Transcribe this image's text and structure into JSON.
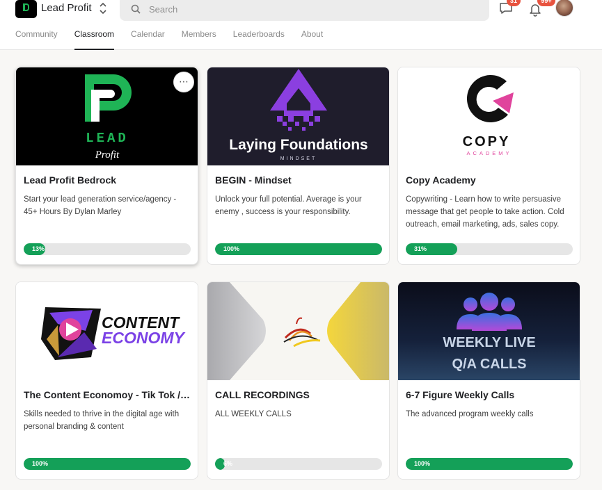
{
  "header": {
    "group_name": "Lead Profit",
    "search_placeholder": "Search",
    "chat_badge": "31",
    "notifications_badge": "99+"
  },
  "tabs": [
    {
      "label": "Community",
      "active": false
    },
    {
      "label": "Classroom",
      "active": true
    },
    {
      "label": "Calendar",
      "active": false
    },
    {
      "label": "Members",
      "active": false
    },
    {
      "label": "Leaderboards",
      "active": false
    },
    {
      "label": "About",
      "active": false
    }
  ],
  "courses": [
    {
      "title": "Lead Profit Bedrock",
      "description": "Start your lead generation service/agency - 45+ Hours By Dylan Marley",
      "progress": 13,
      "progress_label": "13%",
      "thumb": {
        "line1": "LEAD",
        "line2": "Profit"
      }
    },
    {
      "title": "BEGIN - Mindset",
      "description": "Unlock your full potential. Average is your enemy , success is your responsibility.",
      "progress": 100,
      "progress_label": "100%",
      "thumb": {
        "line1": "Laying Foundations",
        "line2": "MINDSET"
      }
    },
    {
      "title": "Copy Academy",
      "description": "Copywriting - Learn how to write persuasive message that get people to take action. Cold outreach, email marketing, ads, sales copy.",
      "progress": 31,
      "progress_label": "31%",
      "thumb": {
        "line1": "COPY",
        "line2": "ACADEMY"
      }
    },
    {
      "title": "The Content Economoy - Tik Tok / Instagram",
      "description": "Skills needed to thrive in the digital age with personal branding & content",
      "progress": 100,
      "progress_label": "100%",
      "thumb": {
        "line1": "CONTENT",
        "line2": "ECONOMY"
      }
    },
    {
      "title": "CALL RECORDINGS",
      "description": "ALL WEEKLY CALLS",
      "progress": 6,
      "progress_label": "6%",
      "thumb": {}
    },
    {
      "title": "6-7 Figure Weekly Calls",
      "description": "The advanced program weekly calls",
      "progress": 100,
      "progress_label": "100%",
      "thumb": {
        "line1": "WEEKLY LIVE",
        "line2": "Q/A CALLS"
      }
    }
  ],
  "colors": {
    "progress_fill": "#14a058",
    "progress_track": "#e6e6e6",
    "badge": "#e8533f",
    "brand_green": "#1fb456",
    "mindset_purple": "#8b3fe0",
    "copy_pink": "#e0439c",
    "content_purple": "#7b42e6"
  },
  "icons": [
    "group-logo-icon",
    "switch-group-icon",
    "search-icon",
    "chat-icon",
    "bell-icon",
    "more-options-icon"
  ]
}
